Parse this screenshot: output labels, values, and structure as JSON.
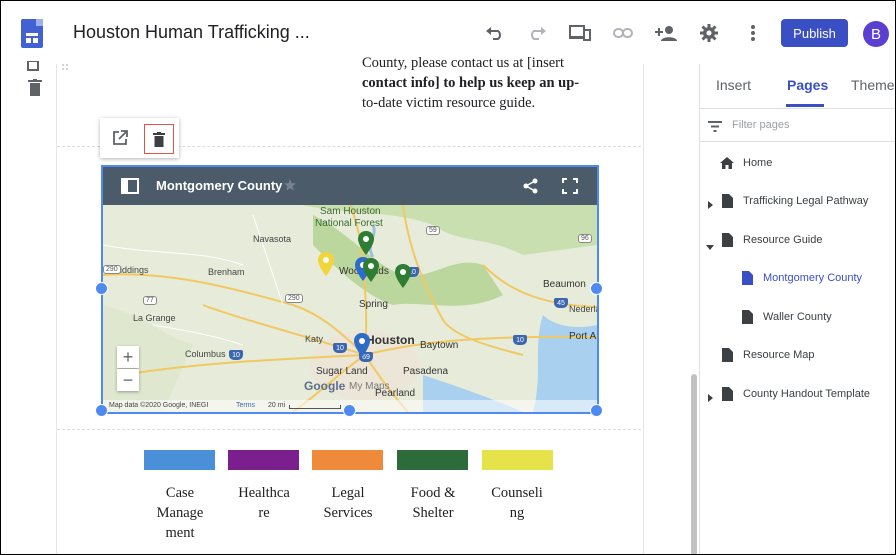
{
  "header": {
    "site_title": "Houston Human Trafficking ...",
    "publish_label": "Publish",
    "avatar_letter": "B",
    "icons": [
      "undo-icon",
      "redo-icon",
      "preview-devices-icon",
      "link-icon",
      "share-add-person-icon",
      "settings-gear-icon",
      "more-vert-icon"
    ]
  },
  "rail": {
    "icons": [
      "duplicate-icon",
      "delete-icon"
    ]
  },
  "content": {
    "intro_text": "County, please contact us at [insert contact info] to help us keep an up-to-date victim resource guide.",
    "intro_lines": [
      "County, please contact us at [insert",
      "contact info] to help us keep an up-",
      "to-date victim resource guide."
    ],
    "float_toolbar": {
      "icons": [
        "open-in-new-icon",
        "trash-icon"
      ]
    }
  },
  "map": {
    "title": "Montgomery County",
    "attribution": {
      "data": "Map data ©2020 Google, INEGI",
      "terms": "Terms",
      "scale": "20 mi"
    },
    "places": {
      "sam_houston_1": "Sam Houston",
      "sam_houston_2": "National Forest",
      "navasota": "Navasota",
      "giddings": "Giddings",
      "brenham": "Brenham",
      "woodlands": "Woodlands",
      "beaumont": "Beaumon",
      "spring": "Spring",
      "nederland": "Nederla",
      "la_grange": "La Grange",
      "katy": "Katy",
      "houston": "Houston",
      "baytown": "Baytown",
      "columbus": "Columbus",
      "port": "Port A",
      "sugar_land": "Sugar Land",
      "pasadena": "Pasadena",
      "pearland": "Pearland",
      "google_logo": "Google",
      "my_maps": "My Maps"
    },
    "highways": [
      "59",
      "96",
      "290",
      "77",
      "10",
      "290",
      "45",
      "10",
      "10",
      "69",
      "45",
      "10",
      "87",
      "59",
      "290"
    ],
    "pin_colors": {
      "green": "#2e7d32",
      "yellow": "#f2d43b",
      "blue": "#2f6cc9"
    }
  },
  "legend": [
    {
      "label_lines": [
        "Case",
        "Manage",
        "ment"
      ],
      "color": "#4a90d9"
    },
    {
      "label_lines": [
        "Healthca",
        "re"
      ],
      "color": "#7b1f8f"
    },
    {
      "label_lines": [
        "Legal",
        "Services"
      ],
      "color": "#ef8a3a"
    },
    {
      "label_lines": [
        "Food &",
        "Shelter"
      ],
      "color": "#2e6b3a"
    },
    {
      "label_lines": [
        "Counseli",
        "ng"
      ],
      "color": "#e6e24a"
    }
  ],
  "panel": {
    "tabs": [
      "Insert",
      "Pages",
      "Themes"
    ],
    "active_tab": "Pages",
    "filter_placeholder": "Filter pages",
    "pages": [
      {
        "label": "Home",
        "icon": "home-icon"
      },
      {
        "label": "Trafficking Legal Pathway",
        "icon": "page-icon",
        "expander": "collapsed"
      },
      {
        "label": "Resource Guide",
        "icon": "page-icon",
        "expander": "expanded"
      },
      {
        "label": "Montgomery County",
        "icon": "page-icon",
        "active": true
      },
      {
        "label": "Waller County",
        "icon": "page-icon"
      },
      {
        "label": "Resource Map",
        "icon": "page-icon"
      },
      {
        "label": "County Handout Template",
        "icon": "page-icon",
        "expander": "collapsed"
      }
    ]
  },
  "colors": {
    "accent": "#3b4fc4",
    "selection": "#4e8af0",
    "map_header": "#4b5b69",
    "delete_highlight": "#e0544c"
  }
}
